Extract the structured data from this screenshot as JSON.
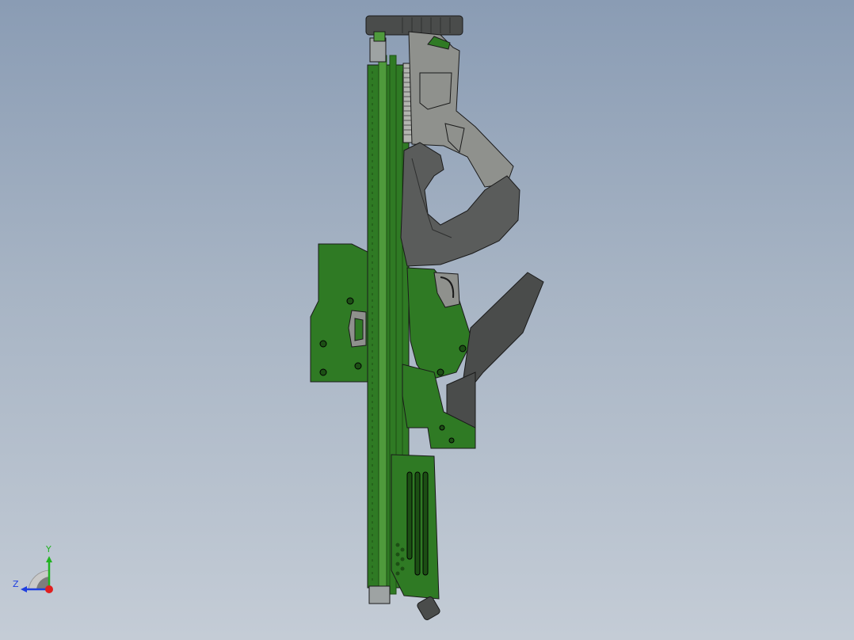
{
  "viewport": {
    "background_top": "#8a9cb4",
    "background_bottom": "#c4ccd6"
  },
  "model": {
    "colors": {
      "green": "#2f7a24",
      "green_dark": "#1c4f14",
      "green_light": "#4f9a3c",
      "gray_part": "#8f918d",
      "gray_light": "#b3b5b0",
      "dark_part": "#4a4c4b",
      "outline": "#1a1a1a",
      "barrel": "#9ea3a3"
    }
  },
  "triad": {
    "y_label": "Y",
    "z_label": "Z",
    "colors": {
      "y_axis": "#21b321",
      "z_axis": "#1f3fe0",
      "x_axis": "#e01f1f"
    }
  }
}
